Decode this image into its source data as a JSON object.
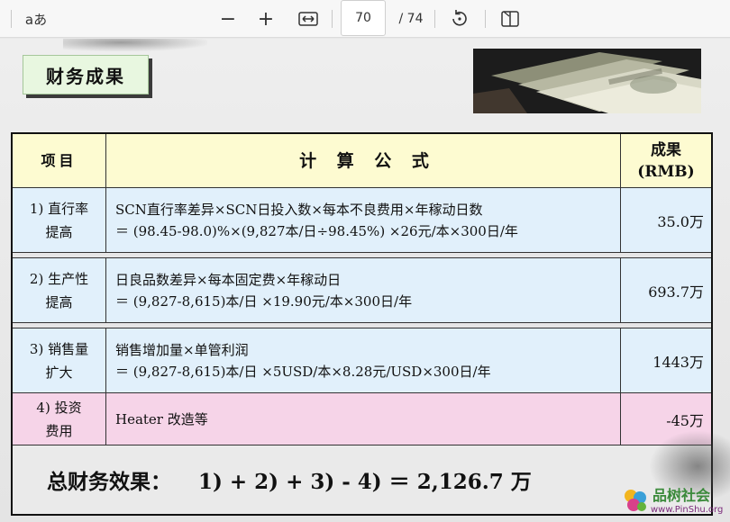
{
  "toolbar": {
    "draw_text_label": "aあ",
    "zoom_out_label": "−",
    "zoom_in_label": "+",
    "current_page": "70",
    "total_pages": "/ 74"
  },
  "slide": {
    "title": "财务成果",
    "table": {
      "headers": {
        "item": "项目",
        "formula": "计 算 公 式",
        "result_line1": "成果",
        "result_line2": "(RMB)"
      },
      "rows": [
        {
          "item_line1": "1) 直行率",
          "item_line2": "提高",
          "formula_line1": "SCN直行率差异×SCN日投入数×每本不良费用×年稼动日数",
          "formula_line2": "＝ (98.45-98.0)%×(9,827本/日÷98.45%) ×26元/本×300日/年",
          "result": "35.0万"
        },
        {
          "item_line1": "2) 生产性",
          "item_line2": "提高",
          "formula_line1": "日良品数差异×每本固定费×年稼动日",
          "formula_line2": "＝ (9,827-8,615)本/日 ×19.90元/本×300日/年",
          "result": "693.7万"
        },
        {
          "item_line1": "3) 销售量",
          "item_line2": "扩大",
          "formula_line1": "销售增加量×单管利润",
          "formula_line2": "＝ (9,827-8,615)本/日 ×5USD/本×8.28元/USD×300日/年",
          "result": "1443万"
        },
        {
          "item_line1": "4) 投资",
          "item_line2": "费用",
          "formula_line1": "Heater 改造等",
          "result": "-45万"
        }
      ],
      "total_label": "总财务效果：",
      "total_formula": "1) + 2) + 3) - 4)  ＝ 2,126.7 万"
    },
    "watermark_cn": "品树社会",
    "watermark_url": "www.PinShu.org"
  },
  "colors": {
    "header_bg": "#fdfbd1",
    "row_blue": "#e1f0fb",
    "row_pink": "#f6d4e8",
    "title_bg": "#e8f7e0"
  },
  "icons": [
    "zoom-out-icon",
    "zoom-in-icon",
    "fit-width-icon",
    "rotate-icon",
    "two-page-icon",
    "money-photo"
  ]
}
